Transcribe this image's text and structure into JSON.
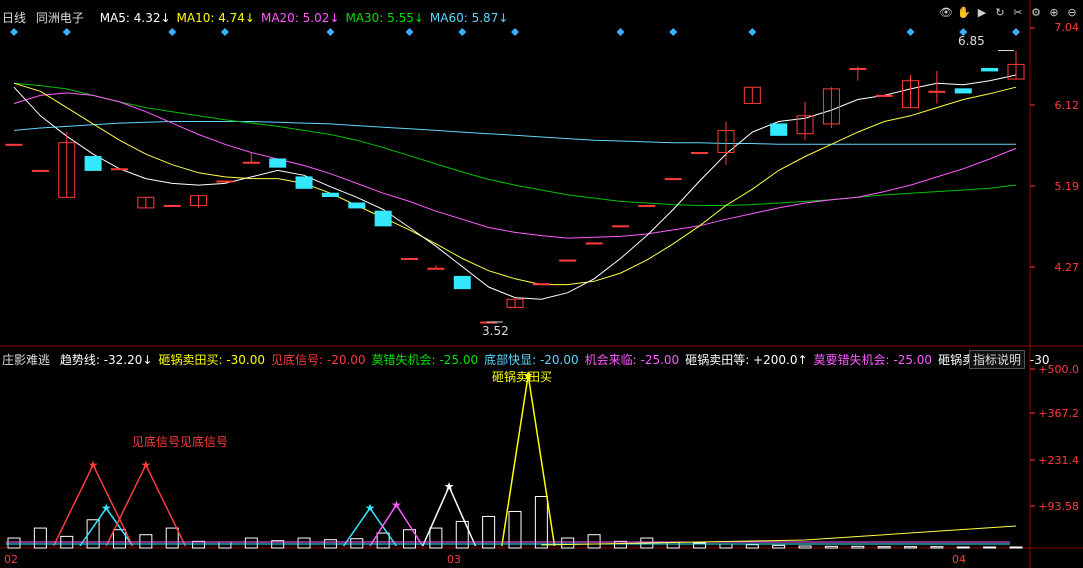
{
  "header": {
    "period": "日线",
    "stock_name": "同洲电子",
    "ma": [
      {
        "label": "MA5: ",
        "value": "4.32",
        "arrow": "↓",
        "color": "#ffffff"
      },
      {
        "label": "MA10: ",
        "value": "4.74",
        "arrow": "↓",
        "color": "#ffff00"
      },
      {
        "label": "MA20: ",
        "value": "5.02",
        "arrow": "↓",
        "color": "#ff5cff"
      },
      {
        "label": "MA30: ",
        "value": "5.55",
        "arrow": "↓",
        "color": "#00e000"
      },
      {
        "label": "MA60: ",
        "value": "5.87",
        "arrow": "↓",
        "color": "#5fd7ff"
      }
    ]
  },
  "price_axis": [
    "7.04",
    "6.12",
    "5.19",
    "4.27"
  ],
  "price_high_label": "6.85",
  "price_low_label": "3.52",
  "indicator": {
    "name": "庄影难逃",
    "items": [
      {
        "label": "趋势线: ",
        "value": "-32.20",
        "arrow": "↓",
        "color": "#ffffff"
      },
      {
        "label": "砸锅卖田买: ",
        "value": "-30.00",
        "arrow": "",
        "color": "#ffff00"
      },
      {
        "label": "见底信号: ",
        "value": "-20.00",
        "arrow": "",
        "color": "#ff3b3b"
      },
      {
        "label": "莫错失机会: ",
        "value": "-25.00",
        "arrow": "",
        "color": "#00e000"
      },
      {
        "label": "底部快显: ",
        "value": "-20.00",
        "arrow": "",
        "color": "#5fd7ff"
      },
      {
        "label": "机会来临: ",
        "value": "-25.00",
        "arrow": "",
        "color": "#ff5cff"
      },
      {
        "label": "砸锅卖田等: ",
        "value": "+200.0",
        "arrow": "↑",
        "color": "#ffffff"
      },
      {
        "label": "莫要错失机会: ",
        "value": "-25.00",
        "arrow": "",
        "color": "#ff5cff"
      },
      {
        "label": "砸锅卖田等看你: ",
        "value": "-30",
        "arrow": "",
        "color": "#ffffff"
      }
    ],
    "explain_button": "指标说明",
    "axis": [
      "+500.0",
      "+367.2",
      "+231.4",
      "+93.58"
    ],
    "annotations": [
      "见底信号见底信号",
      "砸锅卖田买"
    ]
  },
  "date_labels": [
    "02",
    "03",
    "04"
  ],
  "colors": {
    "up": "#ff3b3b",
    "down": "#35e8ff",
    "bg": "#000000"
  },
  "chart_data": {
    "type": "candlestick",
    "price_range": [
      3.3,
      7.2
    ],
    "candles": [
      {
        "o": 5.7,
        "h": 5.7,
        "l": 5.7,
        "c": 5.7
      },
      {
        "o": 5.38,
        "h": 5.38,
        "l": 5.38,
        "c": 5.38
      },
      {
        "o": 5.05,
        "h": 5.85,
        "l": 5.05,
        "c": 5.72
      },
      {
        "o": 5.55,
        "h": 5.55,
        "l": 5.38,
        "c": 5.38
      },
      {
        "o": 5.4,
        "h": 5.4,
        "l": 5.4,
        "c": 5.4
      },
      {
        "o": 4.92,
        "h": 5.05,
        "l": 4.92,
        "c": 5.05
      },
      {
        "o": 4.95,
        "h": 4.95,
        "l": 4.95,
        "c": 4.95
      },
      {
        "o": 4.95,
        "h": 5.07,
        "l": 4.92,
        "c": 5.07
      },
      {
        "o": 5.25,
        "h": 5.25,
        "l": 5.25,
        "c": 5.25
      },
      {
        "o": 5.48,
        "h": 5.6,
        "l": 5.48,
        "c": 5.48
      },
      {
        "o": 5.52,
        "h": 5.52,
        "l": 5.42,
        "c": 5.42
      },
      {
        "o": 5.3,
        "h": 5.3,
        "l": 5.16,
        "c": 5.16
      },
      {
        "o": 5.1,
        "h": 5.1,
        "l": 5.06,
        "c": 5.06
      },
      {
        "o": 4.98,
        "h": 4.98,
        "l": 4.92,
        "c": 4.92
      },
      {
        "o": 4.88,
        "h": 4.88,
        "l": 4.7,
        "c": 4.7
      },
      {
        "o": 4.3,
        "h": 4.3,
        "l": 4.3,
        "c": 4.3
      },
      {
        "o": 4.18,
        "h": 4.22,
        "l": 4.18,
        "c": 4.18
      },
      {
        "o": 4.08,
        "h": 4.08,
        "l": 3.93,
        "c": 3.93
      },
      {
        "o": 3.52,
        "h": 3.52,
        "l": 3.52,
        "c": 3.52
      },
      {
        "o": 3.7,
        "h": 3.8,
        "l": 3.7,
        "c": 3.8
      },
      {
        "o": 3.99,
        "h": 3.99,
        "l": 3.99,
        "c": 3.99
      },
      {
        "o": 4.28,
        "h": 4.28,
        "l": 4.28,
        "c": 4.28
      },
      {
        "o": 4.49,
        "h": 4.49,
        "l": 4.49,
        "c": 4.49
      },
      {
        "o": 4.7,
        "h": 4.7,
        "l": 4.7,
        "c": 4.7
      },
      {
        "o": 4.95,
        "h": 4.95,
        "l": 4.95,
        "c": 4.95
      },
      {
        "o": 5.28,
        "h": 5.28,
        "l": 5.28,
        "c": 5.28
      },
      {
        "o": 5.6,
        "h": 5.6,
        "l": 5.6,
        "c": 5.6
      },
      {
        "o": 5.6,
        "h": 5.98,
        "l": 5.45,
        "c": 5.87
      },
      {
        "o": 6.2,
        "h": 6.4,
        "l": 6.2,
        "c": 6.4
      },
      {
        "o": 5.95,
        "h": 5.95,
        "l": 5.81,
        "c": 5.81
      },
      {
        "o": 5.83,
        "h": 6.22,
        "l": 5.75,
        "c": 6.05
      },
      {
        "o": 5.95,
        "h": 6.4,
        "l": 5.9,
        "c": 6.38
      },
      {
        "o": 6.63,
        "h": 6.65,
        "l": 6.48,
        "c": 6.63
      },
      {
        "o": 6.3,
        "h": 6.3,
        "l": 6.3,
        "c": 6.3
      },
      {
        "o": 6.15,
        "h": 6.55,
        "l": 6.15,
        "c": 6.48
      },
      {
        "o": 6.35,
        "h": 6.6,
        "l": 6.2,
        "c": 6.35
      },
      {
        "o": 6.38,
        "h": 6.38,
        "l": 6.33,
        "c": 6.33
      },
      {
        "o": 6.63,
        "h": 6.63,
        "l": 6.6,
        "c": 6.6
      },
      {
        "o": 6.5,
        "h": 6.85,
        "l": 6.5,
        "c": 6.68
      }
    ],
    "ma5": [
      6.4,
      6.05,
      5.8,
      5.58,
      5.4,
      5.28,
      5.22,
      5.2,
      5.22,
      5.3,
      5.38,
      5.32,
      5.18,
      5.05,
      4.9,
      4.68,
      4.45,
      4.2,
      3.95,
      3.82,
      3.8,
      3.88,
      4.05,
      4.3,
      4.58,
      4.9,
      5.25,
      5.58,
      5.85,
      5.98,
      6.02,
      6.12,
      6.25,
      6.3,
      6.38,
      6.45,
      6.43,
      6.48,
      6.55
    ],
    "ma10": [
      6.45,
      6.35,
      6.15,
      5.95,
      5.75,
      5.58,
      5.45,
      5.35,
      5.3,
      5.28,
      5.28,
      5.22,
      5.1,
      4.95,
      4.8,
      4.65,
      4.48,
      4.3,
      4.15,
      4.05,
      3.98,
      3.98,
      4.02,
      4.12,
      4.28,
      4.48,
      4.7,
      4.95,
      5.15,
      5.38,
      5.55,
      5.7,
      5.85,
      5.98,
      6.05,
      6.15,
      6.25,
      6.32,
      6.4
    ],
    "ma20": [
      6.2,
      6.3,
      6.33,
      6.3,
      6.22,
      6.1,
      5.96,
      5.82,
      5.7,
      5.6,
      5.52,
      5.44,
      5.34,
      5.22,
      5.1,
      5.0,
      4.88,
      4.78,
      4.68,
      4.62,
      4.58,
      4.55,
      4.56,
      4.57,
      4.6,
      4.65,
      4.7,
      4.78,
      4.85,
      4.92,
      4.98,
      5.02,
      5.05,
      5.12,
      5.2,
      5.3,
      5.4,
      5.52,
      5.65
    ],
    "ma30": [
      6.45,
      6.42,
      6.38,
      6.3,
      6.22,
      6.15,
      6.1,
      6.05,
      6.0,
      5.96,
      5.92,
      5.87,
      5.82,
      5.75,
      5.66,
      5.56,
      5.46,
      5.36,
      5.27,
      5.2,
      5.14,
      5.08,
      5.04,
      5.0,
      4.98,
      4.96,
      4.95,
      4.95,
      4.96,
      4.98,
      5.0,
      5.02,
      5.05,
      5.08,
      5.1,
      5.12,
      5.14,
      5.16,
      5.2
    ],
    "ma60": [
      5.87,
      5.9,
      5.92,
      5.94,
      5.96,
      5.97,
      5.98,
      5.98,
      5.98,
      5.98,
      5.97,
      5.96,
      5.95,
      5.93,
      5.91,
      5.89,
      5.87,
      5.85,
      5.83,
      5.81,
      5.79,
      5.77,
      5.75,
      5.74,
      5.73,
      5.72,
      5.72,
      5.71,
      5.71,
      5.7,
      5.7,
      5.7,
      5.7,
      5.7,
      5.7,
      5.7,
      5.7,
      5.7,
      5.7
    ],
    "ind_range": [
      0,
      560
    ],
    "ind_bars": [
      30,
      60,
      35,
      85,
      55,
      40,
      60,
      20,
      18,
      30,
      22,
      30,
      25,
      28,
      45,
      55,
      60,
      80,
      95,
      110,
      155,
      30,
      40,
      20,
      30,
      18,
      15,
      12,
      10,
      8,
      6,
      5,
      5,
      4,
      4,
      4,
      3,
      3,
      3
    ],
    "ind_triangles": [
      {
        "i1": 3,
        "i2": 5,
        "peak": 120,
        "color": "#35e8ff"
      },
      {
        "i1": 13,
        "i2": 15,
        "peak": 120,
        "color": "#35e8ff"
      },
      {
        "i1": 14,
        "i2": 16,
        "peak": 130,
        "color": "#ff5cff"
      },
      {
        "i1": 16,
        "i2": 18,
        "peak": 185,
        "color": "#ffffff"
      },
      {
        "i1": 19,
        "i2": 21,
        "peak": 520,
        "color": "#ffff00"
      },
      {
        "i1": 4,
        "i2": 7,
        "peak": 250,
        "color": "#ff3b3b"
      },
      {
        "i1": 2,
        "i2": 5,
        "peak": 250,
        "color": "#ff3b3b"
      }
    ]
  }
}
